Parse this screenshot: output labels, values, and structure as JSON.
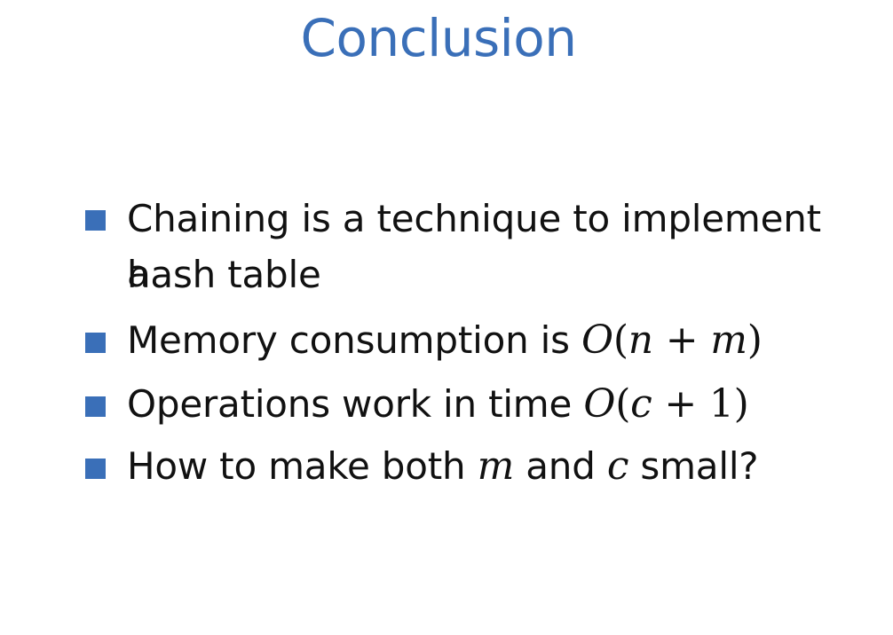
{
  "colors": {
    "accent": "#3a6fb8",
    "text": "#111111",
    "background": "#ffffff"
  },
  "slide": {
    "title": "Conclusion",
    "bullets": [
      {
        "text_line1": "Chaining is a technique to implement a",
        "text_line2": "hash table"
      },
      {
        "text": "Memory consumption is ",
        "math_O": "O",
        "math_open": "(",
        "math_a": "n",
        "math_op": " + ",
        "math_b": "m",
        "math_close": ")"
      },
      {
        "text": "Operations work in time ",
        "math_O": "O",
        "math_open": "(",
        "math_a": "c",
        "math_op": " + ",
        "math_b": "1",
        "math_close": ")"
      },
      {
        "text_pre": "How to make both ",
        "var1": "m",
        "text_mid": " and ",
        "var2": "c",
        "text_post": " small?"
      }
    ]
  }
}
